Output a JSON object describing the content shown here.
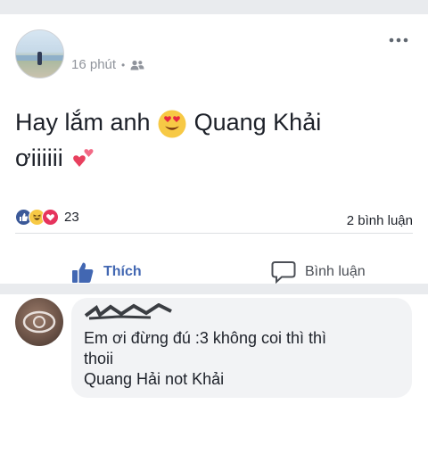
{
  "post": {
    "time": "16 phút",
    "dot": "•",
    "audience_icon": "friends-icon",
    "more_icon": "more-dots-icon",
    "text_line1": "Hay lắm anh",
    "text_after_emoji": "Quang Khải",
    "text_line2": "ơiiiiii",
    "reactions": [
      "like",
      "haha",
      "love"
    ],
    "reaction_count": "23",
    "comment_count": "2 bình luận",
    "like_label": "Thích",
    "comment_label": "Bình luận"
  },
  "comment": {
    "line1": "Em ơi đừng đú :3 không coi thì thì",
    "line2": "thoii",
    "line3": "Quang Hải not Khải"
  },
  "colors": {
    "like_blue": "#4267b2",
    "love_red": "#e6345d",
    "haha_yellow": "#f7c945",
    "separator": "#e9ebee"
  }
}
